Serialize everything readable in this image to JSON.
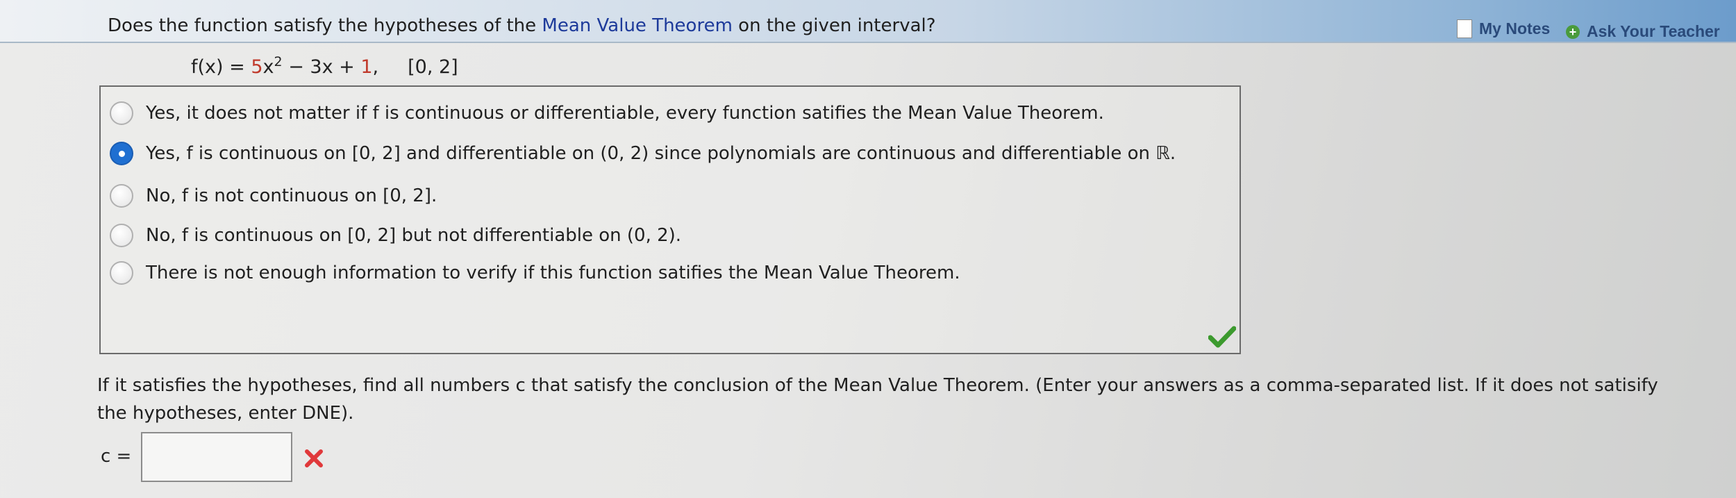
{
  "header": {
    "my_notes": "My Notes",
    "ask_teacher": "Ask Your Teacher",
    "icons": [
      "notes-doc-icon",
      "plus-circle-icon"
    ]
  },
  "question": {
    "prefix": "Does the function satisfy the hypotheses of the ",
    "theorem": "Mean Value Theorem",
    "suffix": " on the given interval?"
  },
  "formula": {
    "lhs": "f(x) = ",
    "coef": "5",
    "var": "x",
    "exp": "2",
    "mid": " − 3x + ",
    "const": "1",
    "comma": ",",
    "interval": "[0, 2]"
  },
  "options": [
    {
      "label": "Yes, it does not matter if f is continuous or differentiable, every function satifies the Mean Value Theorem.",
      "selected": false
    },
    {
      "label": "Yes, f is continuous on [0, 2] and differentiable on (0, 2) since polynomials are continuous and differentiable on ℝ.",
      "selected": true
    },
    {
      "label": "No, f is not continuous on [0, 2].",
      "selected": false
    },
    {
      "label": "No, f is continuous on [0, 2] but not differentiable on (0, 2).",
      "selected": false
    },
    {
      "label": "There is not enough information to verify if this function satifies the Mean Value Theorem.",
      "selected": false
    }
  ],
  "followup": {
    "text": "If it satisfies the hypotheses, find all numbers c that satisfy the conclusion of the Mean Value Theorem. (Enter your answers as a comma-separated list. If it does not satisify the hypotheses, enter DNE).",
    "c_label": "c =",
    "c_value": ""
  },
  "colors": {
    "accent_blue": "#1f6fd1",
    "correct_green": "#3c9a2e",
    "wrong_red": "#e0393b"
  }
}
